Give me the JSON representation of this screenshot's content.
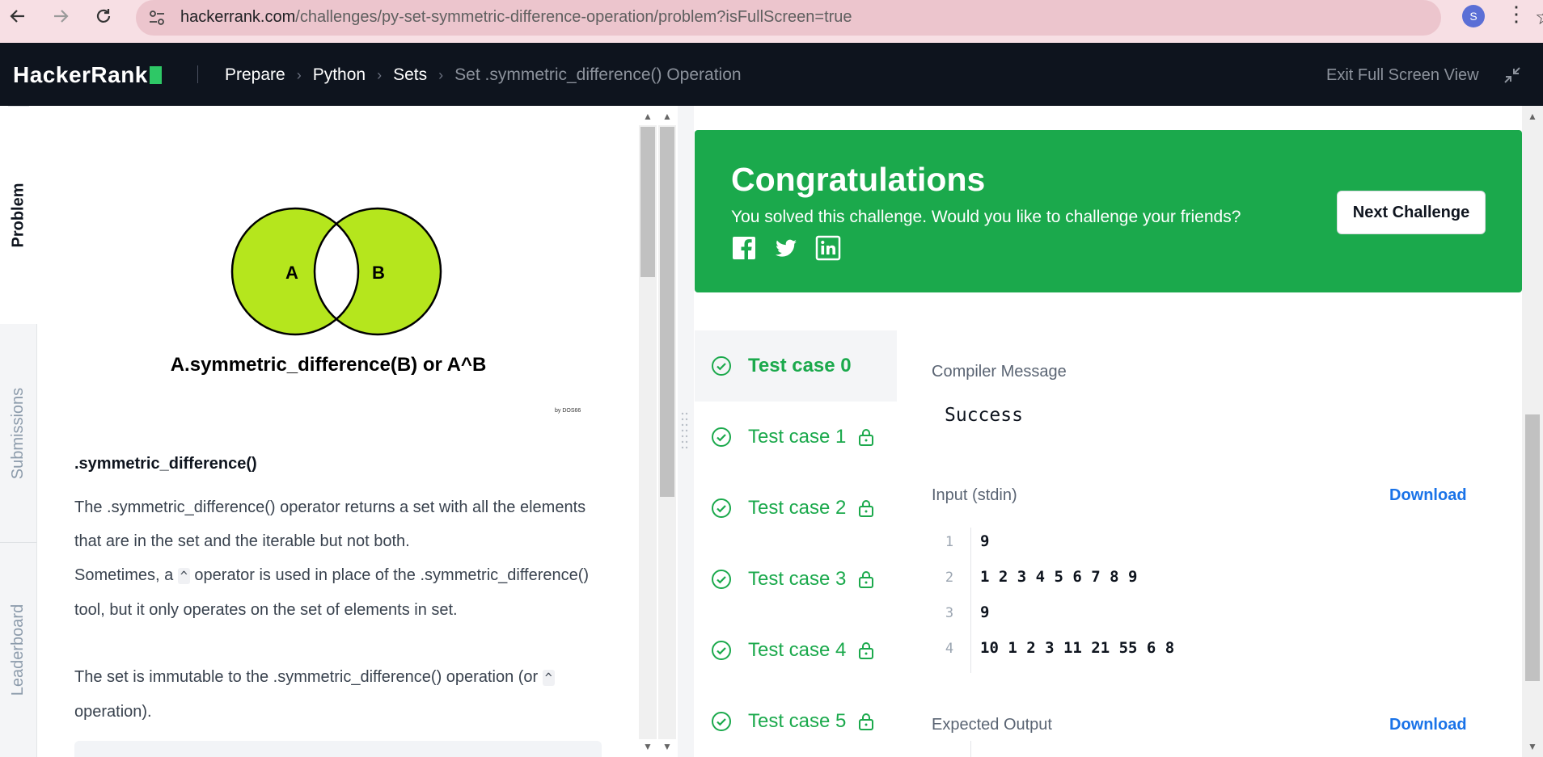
{
  "browser": {
    "url_host": "hackerrank.com",
    "url_path": "/challenges/py-set-symmetric-difference-operation/problem?isFullScreen=true",
    "profile_initial": "S"
  },
  "header": {
    "logo": "HackerRank",
    "breadcrumbs": [
      "Prepare",
      "Python",
      "Sets"
    ],
    "current": "Set .symmetric_difference() Operation",
    "exit_full_screen": "Exit Full Screen View"
  },
  "vertical_tabs": {
    "problem": "Problem",
    "submissions": "Submissions",
    "leaderboard": "Leaderboard"
  },
  "problem": {
    "venn_label_a": "A",
    "venn_label_b": "B",
    "venn_caption": "A.symmetric_difference(B) or A^B",
    "venn_credit": "by DOS66",
    "method_title": ".symmetric_difference()",
    "para1": "The .symmetric_difference() operator returns a set with all the elements that are in the set and the iterable but not both.",
    "para2_before": "Sometimes, a ",
    "para2_code": "^",
    "para2_after": " operator is used in place of the .symmetric_difference() tool, but it only operates on the set of elements in set.",
    "para3_before": "The set is immutable to the .symmetric_difference() operation (or ",
    "para3_code": "^",
    "para3_after": " operation)."
  },
  "result": {
    "title": "Congratulations",
    "subtitle": "You solved this challenge. Would you like to challenge your friends?",
    "next_button": "Next Challenge",
    "colors": {
      "success": "#1ba94c",
      "link": "#1a73e8"
    }
  },
  "test_cases": [
    {
      "label": "Test case 0",
      "locked": false,
      "active": true
    },
    {
      "label": "Test case 1",
      "locked": true,
      "active": false
    },
    {
      "label": "Test case 2",
      "locked": true,
      "active": false
    },
    {
      "label": "Test case 3",
      "locked": true,
      "active": false
    },
    {
      "label": "Test case 4",
      "locked": true,
      "active": false
    },
    {
      "label": "Test case 5",
      "locked": true,
      "active": false
    }
  ],
  "detail": {
    "compiler_label": "Compiler Message",
    "compiler_message": "Success",
    "input_label": "Input (stdin)",
    "download_label": "Download",
    "input_lines": [
      {
        "n": "1",
        "text": "9"
      },
      {
        "n": "2",
        "text": "1 2 3 4 5 6 7 8 9"
      },
      {
        "n": "3",
        "text": "9"
      },
      {
        "n": "4",
        "text": "10 1 2 3 11 21 55 6 8"
      }
    ],
    "expected_label": "Expected Output"
  }
}
